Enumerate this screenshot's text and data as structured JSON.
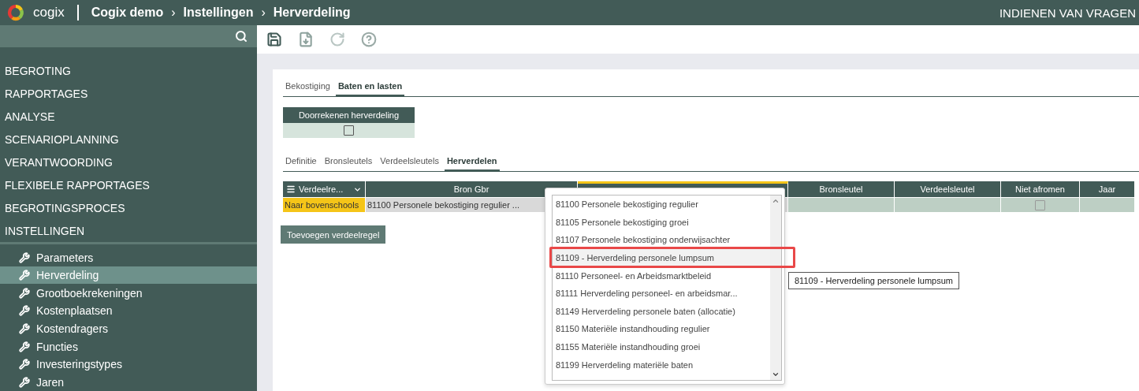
{
  "header": {
    "logo_text": "cogix",
    "breadcrumb": [
      "Cogix demo",
      "Instellingen",
      "Herverdeling"
    ],
    "separator": "›",
    "right_text": "INDIENEN VAN VRAGEN"
  },
  "sidebar": {
    "items": [
      {
        "label": "BEGROTING"
      },
      {
        "label": "RAPPORTAGES"
      },
      {
        "label": "ANALYSE"
      },
      {
        "label": "SCENARIOPLANNING"
      },
      {
        "label": "VERANTWOORDING"
      },
      {
        "label": "FLEXIBELE RAPPORTAGES"
      },
      {
        "label": "BEGROTINGSPROCES"
      },
      {
        "label": "INSTELLINGEN",
        "children": [
          {
            "label": "Parameters",
            "selected": false
          },
          {
            "label": "Herverdeling",
            "selected": true
          },
          {
            "label": "Grootboekrekeningen",
            "selected": false
          },
          {
            "label": "Kostenplaatsen",
            "selected": false
          },
          {
            "label": "Kostendragers",
            "selected": false
          },
          {
            "label": "Functies",
            "selected": false
          },
          {
            "label": "Investeringstypes",
            "selected": false
          },
          {
            "label": "Jaren",
            "selected": false
          }
        ]
      }
    ]
  },
  "tabs": [
    {
      "label": "Bekostiging",
      "selected": false
    },
    {
      "label": "Baten en lasten",
      "selected": true
    }
  ],
  "recalc": {
    "label": "Doorrekenen herverdeling",
    "checked": false
  },
  "subtabs": [
    {
      "label": "Definitie",
      "selected": false
    },
    {
      "label": "Bronsleutels",
      "selected": false
    },
    {
      "label": "Verdeelsleutels",
      "selected": false
    },
    {
      "label": "Herverdelen",
      "selected": true
    }
  ],
  "table": {
    "columns": [
      {
        "label": "Verdeelre...",
        "kind": "menu"
      },
      {
        "label": "Bron Gbr",
        "kind": "plain"
      },
      {
        "kind": "active"
      },
      {
        "label": "Bronsleutel",
        "kind": "plain"
      },
      {
        "label": "Verdeelsleutel",
        "kind": "plain"
      },
      {
        "label": "Niet afromen",
        "kind": "plain"
      },
      {
        "label": "Jaar",
        "kind": "plain"
      }
    ],
    "rows": [
      {
        "cells": [
          {
            "kind": "highlight",
            "text": "Naar bovenschools"
          },
          {
            "kind": "grey",
            "text": "81100 Personele bekostiging regulier ..."
          },
          {
            "kind": "grey",
            "text": ""
          },
          {
            "kind": "green",
            "text": ""
          },
          {
            "kind": "green",
            "text": ""
          },
          {
            "kind": "check",
            "checked": false
          },
          {
            "kind": "green",
            "text": ""
          }
        ]
      }
    ]
  },
  "add_button": "Toevoegen verdeelregel",
  "dropdown": {
    "items": [
      {
        "label": "81100 Personele bekostiging regulier",
        "selected": false
      },
      {
        "label": "81105 Personele bekostiging groei",
        "selected": false
      },
      {
        "label": "81107 Personele bekostiging onderwijsachter",
        "selected": false
      },
      {
        "label": "81109 - Herverdeling personele lumpsum",
        "selected": true
      },
      {
        "label": "81110 Personeel- en Arbeidsmarktbeleid",
        "selected": false
      },
      {
        "label": "81111 Herverdeling personeel- en arbeidsmar...",
        "selected": false
      },
      {
        "label": "81149 Herverdeling personele baten (allocatie)",
        "selected": false
      },
      {
        "label": "81150 Materiële instandhouding regulier",
        "selected": false
      },
      {
        "label": "81155 Materiële instandhouding groei",
        "selected": false
      },
      {
        "label": "81199 Herverdeling materiële baten",
        "selected": false
      }
    ]
  },
  "tooltip": "81109 - Herverdeling personele lumpsum"
}
